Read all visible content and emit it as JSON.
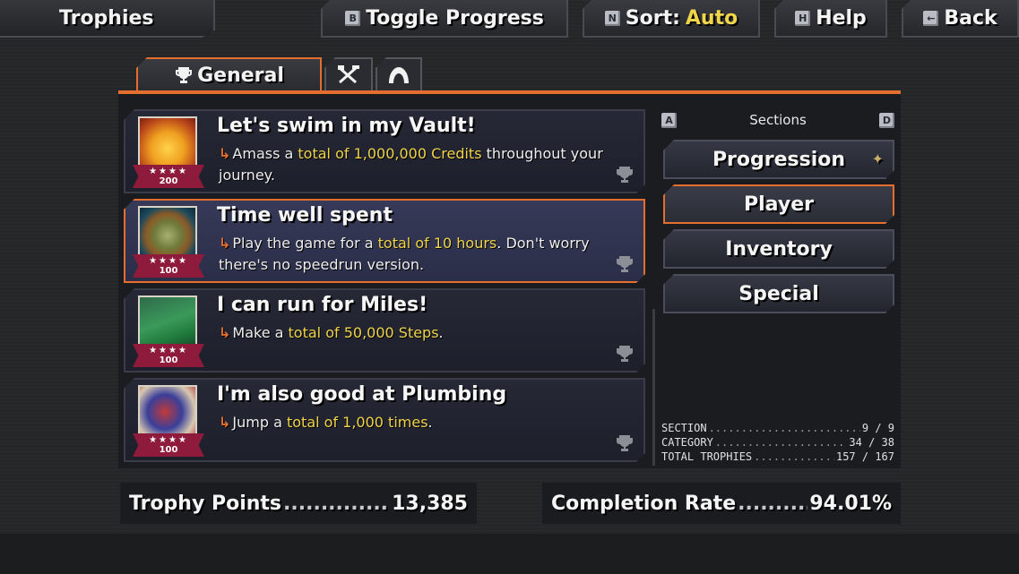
{
  "topbar": {
    "title": "Trophies",
    "toggle": {
      "key": "B",
      "label": "Toggle Progress"
    },
    "sort": {
      "key": "N",
      "label": "Sort:",
      "value": "Auto"
    },
    "help": {
      "key": "H",
      "label": "Help"
    },
    "back": {
      "key": "←",
      "label": "Back"
    }
  },
  "category_tabs": [
    {
      "label": "General",
      "icon": "trophy-icon",
      "active": true
    },
    {
      "label": "",
      "icon": "crossed-tools-icon",
      "active": false
    },
    {
      "label": "",
      "icon": "helmet-icon",
      "active": false
    }
  ],
  "trophies": [
    {
      "title": "Let's swim in my Vault!",
      "desc_pre": "Amass a ",
      "desc_hl": "total of 1,000,000 Credits",
      "desc_post": " throughout your journey.",
      "points": "200",
      "stars": "★★★★",
      "image": "gold-coins-icon",
      "selected": false
    },
    {
      "title": "Time well spent",
      "desc_pre": "Play the game for a ",
      "desc_hl": "total of 10 hours",
      "desc_post": ". Don't worry there's no speedrun version.",
      "points": "100",
      "stars": "★★★★",
      "image": "pocket-watch-icon",
      "selected": true
    },
    {
      "title": "I can run for Miles!",
      "desc_pre": "Make a ",
      "desc_hl": "total of 50,000 Steps",
      "desc_post": ".",
      "points": "100",
      "stars": "★★★★",
      "image": "road-footprints-icon",
      "selected": false
    },
    {
      "title": "I'm also good at Plumbing",
      "desc_pre": "Jump a ",
      "desc_hl": "total of 1,000 times",
      "desc_post": ".",
      "points": "100",
      "stars": "★★★★",
      "image": "jumping-hero-icon",
      "selected": false
    }
  ],
  "sections": {
    "header": "Sections",
    "prev_key": "A",
    "next_key": "D",
    "items": [
      {
        "label": "Progression",
        "active": false
      },
      {
        "label": "Player",
        "active": true
      },
      {
        "label": "Inventory",
        "active": false
      },
      {
        "label": "Special",
        "active": false
      }
    ]
  },
  "stats": [
    {
      "label": "SECTION",
      "value": "9 / 9"
    },
    {
      "label": "CATEGORY",
      "value": "34 / 38"
    },
    {
      "label": "TOTAL TROPHIES",
      "value": "157 / 167"
    }
  ],
  "footer": {
    "points_label": "Trophy Points",
    "points_value": "13,385",
    "completion_label": "Completion Rate",
    "completion_value": "94.01%"
  },
  "colors": {
    "accent": "#e46e2e",
    "highlight": "#f0d44a",
    "ribbon": "#8e1b3c"
  }
}
